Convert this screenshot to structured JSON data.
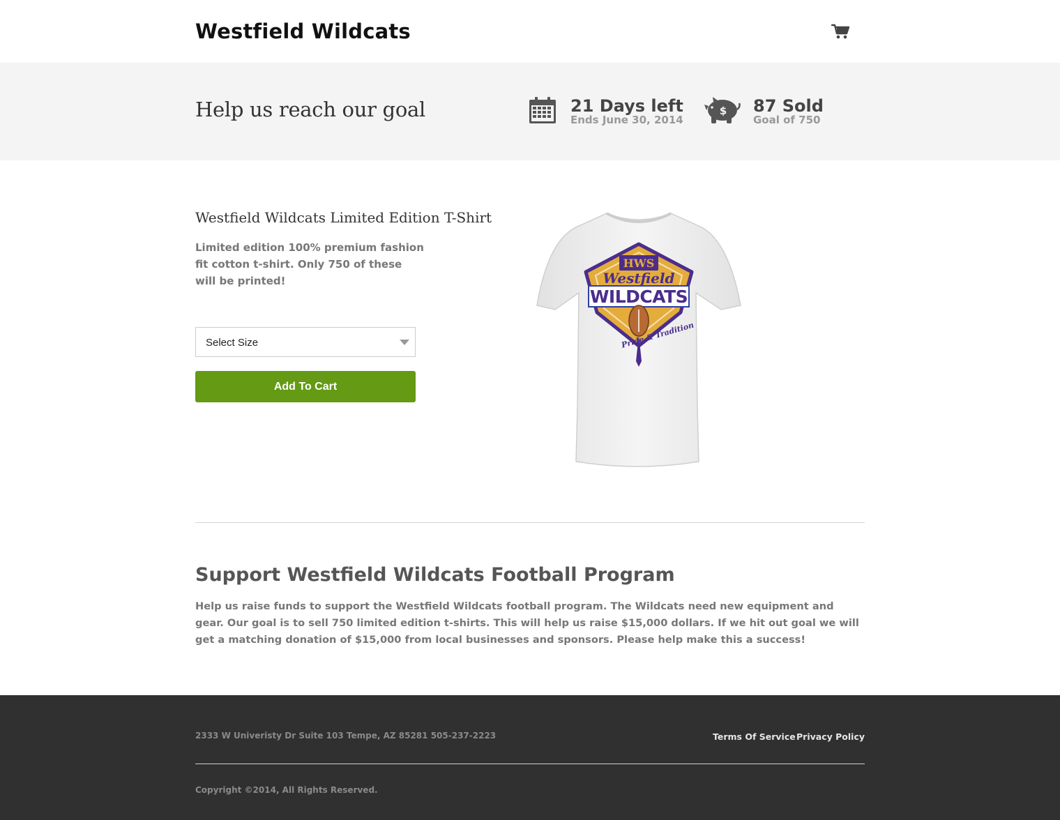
{
  "header": {
    "brand": "Westfield Wildcats",
    "cart_icon": "shopping-cart-icon"
  },
  "goal": {
    "title": "Help us reach our goal",
    "days": {
      "icon": "calendar-icon",
      "headline": "21 Days left",
      "sub": "Ends June 30, 2014"
    },
    "sold": {
      "icon": "piggy-bank-icon",
      "headline": "87 Sold",
      "sub": "Goal of 750",
      "sold_count": 87,
      "goal_count": 750
    }
  },
  "product": {
    "title": "Westfield Wildcats Limited Edition T-Shirt",
    "description": "Limited edition 100% premium fashion fit cotton t-shirt. Only 750 of these will be printed!",
    "size_select": {
      "selected": "Select Size"
    },
    "add_to_cart_label": "Add To Cart",
    "image": {
      "shirt_color": "#f1f1f1",
      "crest_top": "HWS",
      "crest_script": "Westfield",
      "crest_main": "WILDCATS",
      "crest_bottom": "Pride & Tradition",
      "colors": {
        "gold": "#e4ac3c",
        "purple": "#4a2d8c",
        "blue": "#2d3fa7"
      }
    }
  },
  "support": {
    "title": "Support Westfield Wildcats Football Program",
    "text": "Help us raise funds to support the Westfield Wildcats football program. The Wildcats need new equipment and gear. Our goal is to sell 750 limited edition t-shirts. This will help us raise $15,000 dollars. If we hit out goal we will get a matching donation of $15,000 from local businesses and sponsors. Please help make this a success!"
  },
  "footer": {
    "address": "2333 W Univeristy Dr Suite 103 Tempe, AZ 85281 505-237-2223",
    "links": {
      "terms": "Terms Of Service",
      "privacy": "Privacy Policy"
    },
    "copyright": "Copyright ©2014, All Rights Reserved."
  },
  "colors": {
    "accent_green": "#649a14",
    "band_gray": "#f4f4f4",
    "footer_dark": "#303030"
  }
}
